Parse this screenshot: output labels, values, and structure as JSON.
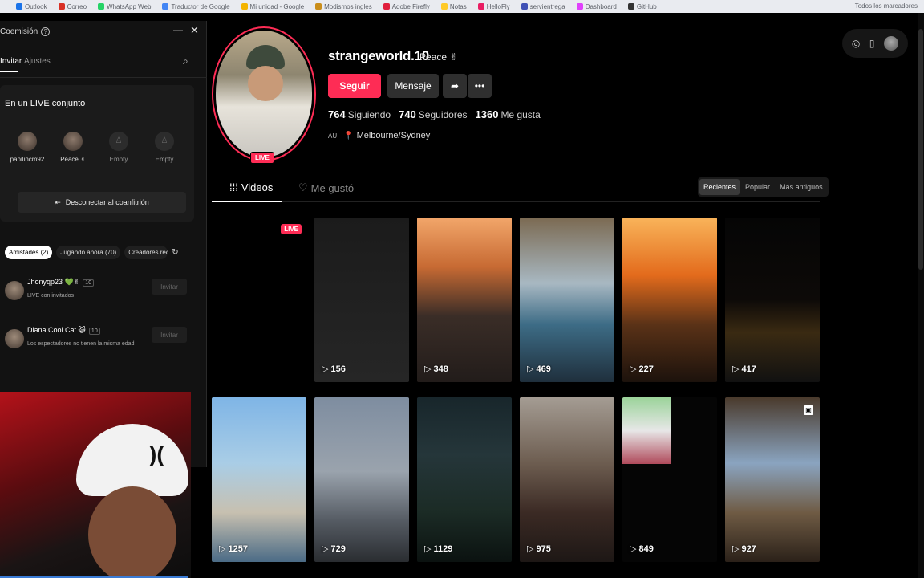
{
  "bookmarks": [
    "Outlook",
    "Correo",
    "WhatsApp Web",
    "Traductor de Google",
    "Mi unidad - Google",
    "Modismos ingles",
    "Adobe Firefly",
    "Notas",
    "HelloFly",
    "servientrega",
    "Dashboard",
    "GitHub"
  ],
  "bookmarks_right": "Todos los marcadores",
  "profile": {
    "username": "strangeworld.10",
    "nickname": "Peace ✌",
    "live_badge": "LIVE",
    "follow_label": "Seguir",
    "message_label": "Mensaje",
    "following_count": "764",
    "following_label": "Siguiendo",
    "followers_count": "740",
    "followers_label": "Seguidores",
    "likes_count": "1360",
    "likes_label": "Me gusta",
    "country": "AU",
    "location": "Melbourne/Sydney"
  },
  "tabs": {
    "videos": "Videos",
    "liked": "Me gustó"
  },
  "sort": [
    "Recientes",
    "Popular",
    "Más antiguos"
  ],
  "videos": [
    {
      "views": "",
      "live": "LIVE"
    },
    {
      "views": "156"
    },
    {
      "views": "348"
    },
    {
      "views": "469"
    },
    {
      "views": "227"
    },
    {
      "views": "417"
    },
    {
      "views": "1257"
    },
    {
      "views": "729"
    },
    {
      "views": "1129"
    },
    {
      "views": "975"
    },
    {
      "views": "849"
    },
    {
      "views": "927"
    }
  ],
  "panel": {
    "title": "Coemisión",
    "tab_invite": "Invitar",
    "tab_settings": "Ajustes",
    "joint_title": "En un LIVE conjunto",
    "slots": [
      "papilincm92",
      "Peace ✌",
      "Empty",
      "Empty"
    ],
    "disconnect_label": "Desconectar al coanfitrión",
    "chips": [
      "Amistades (2)",
      "Jugando ahora (70)",
      "Creadores rec"
    ],
    "friends": [
      {
        "name": "Jhonyqp23 💚✌",
        "badge": "10",
        "status": "LIVE con invitados",
        "invite": "Invitar"
      },
      {
        "name": "Diana Cool Cat 😺",
        "badge": "10",
        "status": "Los espectadores no tienen la misma edad",
        "invite": "Invitar"
      }
    ]
  },
  "colors": {
    "accent": "#fe2c55",
    "background": "#000000",
    "panel": "#121212"
  }
}
